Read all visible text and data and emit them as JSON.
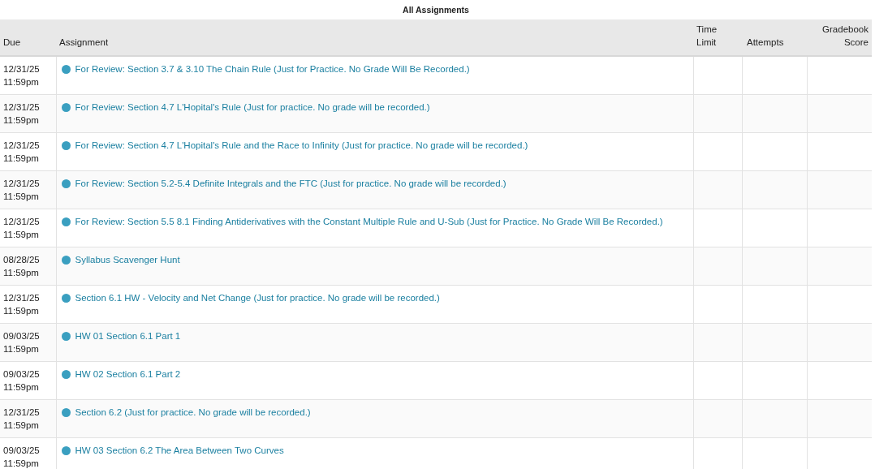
{
  "title": "All Assignments",
  "table": {
    "columns": [
      "Due",
      "Assignment",
      "Time\nLimit",
      "Attempts",
      "Gradebook\nScore"
    ],
    "rows": [
      {
        "due": "12/31/25",
        "time": "11:59pm",
        "assignment": "For Review: Section 3.7 & 3.10 The Chain Rule (Just for Practice. No Grade Will Be Recorded.)"
      },
      {
        "due": "12/31/25",
        "time": "11:59pm",
        "assignment": "For Review: Section 4.7 L'Hopital's Rule (Just for practice. No grade will be recorded.)"
      },
      {
        "due": "12/31/25",
        "time": "11:59pm",
        "assignment": "For Review: Section 4.7 L'Hopital's Rule and the Race to Infinity (Just for practice. No grade will be recorded.)"
      },
      {
        "due": "12/31/25",
        "time": "11:59pm",
        "assignment": "For Review: Section 5.2-5.4 Definite Integrals and the FTC (Just for practice. No grade will be recorded.)"
      },
      {
        "due": "12/31/25",
        "time": "11:59pm",
        "assignment": "For Review: Section 5.5 8.1 Finding Antiderivatives with the Constant Multiple Rule and U-Sub (Just for Practice. No Grade Will Be Recorded.)"
      },
      {
        "due": "08/28/25",
        "time": "11:59pm",
        "assignment": "Syllabus Scavenger Hunt"
      },
      {
        "due": "12/31/25",
        "time": "11:59pm",
        "assignment": "Section 6.1 HW - Velocity and Net Change (Just for practice. No grade will be recorded.)"
      },
      {
        "due": "09/03/25",
        "time": "11:59pm",
        "assignment": "HW 01 Section 6.1 Part 1"
      },
      {
        "due": "09/03/25",
        "time": "11:59pm",
        "assignment": "HW 02 Section 6.1 Part 2"
      },
      {
        "due": "12/31/25",
        "time": "11:59pm",
        "assignment": "Section 6.2 (Just for practice. No grade will be recorded.)"
      },
      {
        "due": "09/03/25",
        "time": "11:59pm",
        "assignment": "HW 03 Section 6.2 The Area Between Two Curves"
      }
    ]
  }
}
